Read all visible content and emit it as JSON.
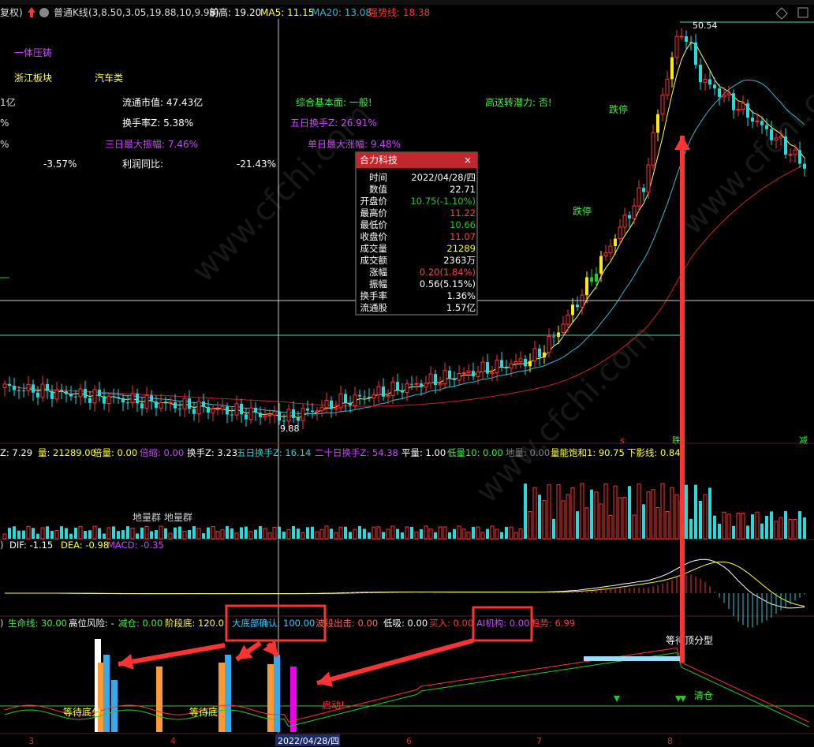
{
  "header": {
    "prefix": "复权)",
    "name": "普通K线",
    "params": "(3,8.50,3.05,19.88,10,9.98)",
    "prev_high_label": "前高: 19.20",
    "ma5_label": "MA5: 11.15",
    "ma20_label": "MA20: 13.08",
    "strong_label": "强势线: 18.38"
  },
  "info": {
    "concept": "一体压铸",
    "sector": "浙江板块",
    "industry": "汽车类",
    "c1": "1亿",
    "c2": "%",
    "c3": "%",
    "mktcap": "流通市值: 47.43亿",
    "turnover_z": "换手率Z: 5.38%",
    "amp3": "三日最大振幅: 7.46%",
    "profit_yoy": "利润同比:",
    "v1": "-3.57%",
    "v2": "-21.43%",
    "fundamental": "综合基本面: 一般!",
    "high_send": "高送转潜力: 否!",
    "turn5": "五日换手Z: 26.91%",
    "maxrise": "单日最大涨幅: 9.48%"
  },
  "tooltip": {
    "title": "合力科技",
    "rows": [
      {
        "k": "时间",
        "v": "2022/04/28/四",
        "c": "#ffffff"
      },
      {
        "k": "数值",
        "v": "22.71",
        "c": "#ffffff"
      },
      {
        "k": "开盘价",
        "v": "10.75(-1.10%)",
        "c": "#22cc22"
      },
      {
        "k": "最高价",
        "v": "11.22",
        "c": "#ff4444"
      },
      {
        "k": "最低价",
        "v": "10.66",
        "c": "#22cc22"
      },
      {
        "k": "收盘价",
        "v": "11.07",
        "c": "#ff4444"
      },
      {
        "k": "成交量",
        "v": "21289",
        "c": "#ffff00"
      },
      {
        "k": "成交额",
        "v": "2363万",
        "c": "#ffffff"
      },
      {
        "k": "涨幅",
        "v": "0.20(1.84%)",
        "c": "#ff4444"
      },
      {
        "k": "振幅",
        "v": "0.56(5.15%)",
        "c": "#ffffff"
      },
      {
        "k": "换手率",
        "v": "1.36%",
        "c": "#ffffff"
      },
      {
        "k": "流通股",
        "v": "1.57亿",
        "c": "#ffffff"
      }
    ]
  },
  "annotations": {
    "high_mark": "50.54",
    "low_mark": "9.88",
    "fall_stop_1": "跌停",
    "fall_stop_2": "跌停",
    "dilimei_1": "地量群",
    "dilimei_2": "地量群",
    "wait_top": "等待顶分型",
    "clear": "清仓",
    "wait_bottom_1": "等待底分",
    "wait_bottom_2": "等待底",
    "start_label": "启动!",
    "mark_s": "s",
    "mark_die": "跌",
    "mark_jian": "减"
  },
  "volume_header": {
    "a": "Z: 7.29",
    "b": "量: 21289.00",
    "c": "倍量: 0.00",
    "d": "倍缩: 0.00",
    "e": "换手Z: 3.23",
    "f": "五日换手Z: 16.14",
    "g": "二十日换手Z: 54.38",
    "h": "平量: 1.00",
    "i": "低量10: 0.00",
    "j": "地量: 0.00",
    "k": "量能饱和1: 90.75",
    "l": "下影线: 0.84"
  },
  "macd_header": {
    "prefix": ")",
    "dif": "DIF: -1.15",
    "dea": "DEA: -0.98",
    "macd": "MACD: -0.35"
  },
  "ind_header": {
    "prefix": ")",
    "life": "生命线: 30.00",
    "risk": "高位风险: -",
    "reduce": "减仓: 0.00",
    "stage_bottom": "阶段底: 120.0",
    "big_bottom": "大底部确认: 100.00",
    "stage_out": "波段出击: 0.00",
    "low_buy": "低吸: 0.00",
    "buy": "买入: 0.00",
    "ai": "AI机构: 0.00",
    "trend": "趋势: 6.99"
  },
  "xaxis": {
    "m3": "3",
    "m4": "4",
    "cursor_date": "2022/04/28/四",
    "m6": "6",
    "m7": "7",
    "m8": "8"
  },
  "watermark": "www.cfchi.com",
  "colors": {
    "up": "#ff3333",
    "down": "#22dddd",
    "ma5": "#ffff55",
    "ma20": "#33bbcc",
    "ma60": "#cc2222",
    "highlight_box": "#ff3333"
  },
  "chart_data": {
    "type": "candlestick",
    "title": "普通K线",
    "candles_ohlc": [
      [
        11.0,
        11.3,
        10.8,
        11.1
      ],
      [
        11.1,
        11.4,
        10.9,
        11.2
      ],
      [
        11.2,
        11.5,
        11.0,
        11.1
      ],
      [
        11.1,
        11.2,
        10.8,
        10.9
      ],
      [
        10.9,
        11.1,
        10.5,
        10.6
      ],
      [
        10.6,
        10.8,
        10.3,
        10.4
      ],
      [
        10.4,
        10.7,
        10.2,
        10.6
      ],
      [
        10.6,
        10.8,
        10.4,
        10.5
      ],
      [
        10.5,
        10.6,
        10.2,
        10.3
      ],
      [
        10.3,
        10.5,
        10.1,
        10.4
      ],
      [
        10.4,
        10.6,
        10.2,
        10.3
      ],
      [
        10.3,
        10.4,
        10.0,
        10.1
      ],
      [
        10.1,
        10.3,
        9.9,
        10.2
      ],
      [
        10.2,
        10.4,
        10.0,
        10.1
      ],
      [
        10.1,
        10.2,
        9.88,
        10.0
      ],
      [
        10.0,
        10.4,
        9.9,
        10.3
      ],
      [
        10.3,
        10.6,
        10.2,
        10.5
      ],
      [
        10.5,
        10.7,
        10.3,
        10.4
      ],
      [
        10.4,
        10.8,
        10.3,
        10.7
      ],
      [
        10.7,
        10.9,
        10.5,
        10.6
      ],
      [
        10.6,
        11.0,
        10.5,
        10.9
      ],
      [
        10.9,
        11.2,
        10.7,
        11.0
      ],
      [
        11.0,
        11.4,
        10.9,
        11.3
      ],
      [
        11.3,
        11.9,
        11.2,
        11.8
      ],
      [
        11.8,
        12.4,
        11.6,
        12.2
      ],
      [
        12.2,
        12.5,
        11.9,
        12.0
      ],
      [
        12.0,
        12.6,
        11.8,
        12.5
      ],
      [
        12.5,
        13.8,
        12.4,
        13.6
      ],
      [
        13.6,
        15.0,
        13.4,
        14.8
      ],
      [
        14.8,
        16.3,
        14.5,
        16.1
      ],
      [
        16.1,
        17.9,
        15.8,
        17.7
      ],
      [
        17.7,
        19.5,
        17.2,
        19.4
      ],
      [
        19.4,
        21.3,
        18.9,
        21.2
      ],
      [
        21.2,
        23.4,
        20.8,
        23.3
      ],
      [
        23.3,
        25.6,
        22.5,
        25.4
      ],
      [
        25.4,
        28.0,
        24.7,
        27.9
      ],
      [
        27.9,
        30.7,
        27.0,
        30.6
      ],
      [
        30.6,
        33.7,
        29.5,
        33.5
      ],
      [
        33.5,
        36.9,
        32.3,
        36.8
      ],
      [
        36.8,
        40.5,
        35.0,
        40.3
      ],
      [
        40.3,
        44.3,
        38.1,
        44.2
      ],
      [
        44.2,
        48.5,
        41.6,
        48.4
      ],
      [
        48.4,
        50.54,
        42.0,
        43.6
      ],
      [
        43.6,
        45.2,
        38.0,
        39.2
      ],
      [
        39.2,
        41.0,
        36.3,
        37.0
      ],
      [
        37.0,
        38.5,
        34.1,
        35.2
      ],
      [
        35.2,
        37.1,
        33.5,
        36.6
      ],
      [
        36.6,
        37.0,
        31.0,
        31.6
      ],
      [
        31.6,
        32.5,
        28.4,
        29.1
      ],
      [
        29.1,
        30.2,
        27.3,
        28.6
      ],
      [
        28.6,
        29.0,
        25.8,
        26.2
      ]
    ]
  }
}
